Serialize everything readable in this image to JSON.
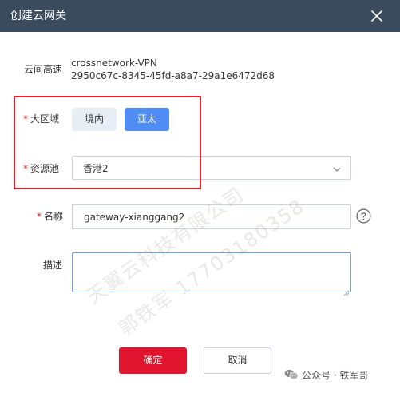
{
  "dialog": {
    "title": "创建云网关"
  },
  "fields": {
    "cloud_link": {
      "label": "云间高速",
      "name": "crossnetwork-VPN",
      "id": "2950c67c-8345-45fd-a8a7-29a1e6472d68"
    },
    "region": {
      "required_mark": "*",
      "label": "大区域",
      "options": [
        "境内",
        "亚太"
      ],
      "selected": "亚太"
    },
    "pool": {
      "required_mark": "*",
      "label": "资源池",
      "value": "香港2"
    },
    "name": {
      "required_mark": "*",
      "label": "名称",
      "value": "gateway-xianggang2"
    },
    "description": {
      "label": "描述",
      "value": ""
    }
  },
  "buttons": {
    "confirm": "确定",
    "cancel": "取消"
  },
  "watermark": {
    "line1": "天翼云科技有限公司",
    "line2": "郭铁军 17703180358"
  },
  "credit": "公众号 · 铁军哥",
  "icons": {
    "close": "close-icon",
    "dropdown": "chevron-down-icon",
    "help": "question-circle-icon",
    "wechat": "wechat-icon"
  },
  "colors": {
    "titlebar": "#3a4b5e",
    "primary": "#4f8df5",
    "confirm": "#e0142d",
    "highlight": "#e8202a",
    "required": "#e02020"
  }
}
